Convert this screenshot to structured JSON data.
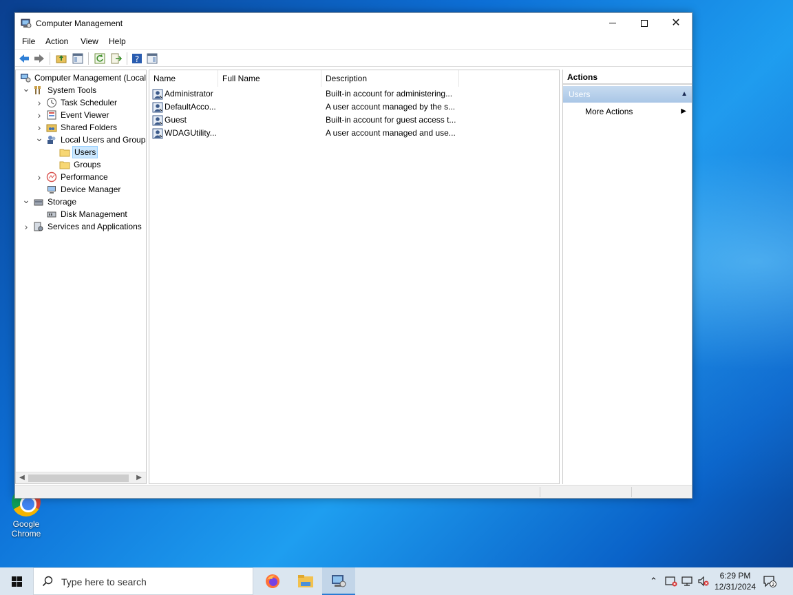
{
  "desktop": {
    "icons": [
      {
        "label_line1": "Google",
        "label_line2": "Chrome"
      }
    ]
  },
  "window": {
    "title": "Computer Management",
    "menu": [
      "File",
      "Action",
      "View",
      "Help"
    ],
    "tree": [
      {
        "label": "Computer Management (Local",
        "level": 0,
        "icon": "computer-management-icon",
        "twisty": ""
      },
      {
        "label": "System Tools",
        "level": 1,
        "icon": "tools-icon",
        "twisty": "down"
      },
      {
        "label": "Task Scheduler",
        "level": 2,
        "icon": "clock-icon",
        "twisty": "right"
      },
      {
        "label": "Event Viewer",
        "level": 2,
        "icon": "event-viewer-icon",
        "twisty": "right"
      },
      {
        "label": "Shared Folders",
        "level": 2,
        "icon": "shared-folder-icon",
        "twisty": "right"
      },
      {
        "label": "Local Users and Groups",
        "level": 2,
        "icon": "users-groups-icon",
        "twisty": "down"
      },
      {
        "label": "Users",
        "level": 3,
        "icon": "folder-icon",
        "twisty": "",
        "selected": true
      },
      {
        "label": "Groups",
        "level": 3,
        "icon": "folder-icon",
        "twisty": ""
      },
      {
        "label": "Performance",
        "level": 2,
        "icon": "performance-icon",
        "twisty": "right"
      },
      {
        "label": "Device Manager",
        "level": 2,
        "icon": "device-manager-icon",
        "twisty": ""
      },
      {
        "label": "Storage",
        "level": 1,
        "icon": "storage-icon",
        "twisty": "down"
      },
      {
        "label": "Disk Management",
        "level": 2,
        "icon": "disk-icon",
        "twisty": ""
      },
      {
        "label": "Services and Applications",
        "level": 1,
        "icon": "services-icon",
        "twisty": "right"
      }
    ],
    "list": {
      "columns": [
        "Name",
        "Full Name",
        "Description"
      ],
      "rows": [
        {
          "name": "Administrator",
          "full_name": "",
          "description": "Built-in account for administering..."
        },
        {
          "name": "DefaultAcco...",
          "full_name": "",
          "description": "A user account managed by the s..."
        },
        {
          "name": "Guest",
          "full_name": "",
          "description": "Built-in account for guest access t..."
        },
        {
          "name": "WDAGUtility...",
          "full_name": "",
          "description": "A user account managed and use..."
        }
      ]
    },
    "actions": {
      "title": "Actions",
      "section": "Users",
      "items": [
        "More Actions"
      ]
    }
  },
  "taskbar": {
    "search_placeholder": "Type here to search",
    "time": "6:29 PM",
    "date": "12/31/2024",
    "notification_count": "2"
  },
  "colors": {
    "selection": "#cce8ff",
    "actions_header": "#b9d1ea",
    "taskbar": "#dbe6f0"
  }
}
